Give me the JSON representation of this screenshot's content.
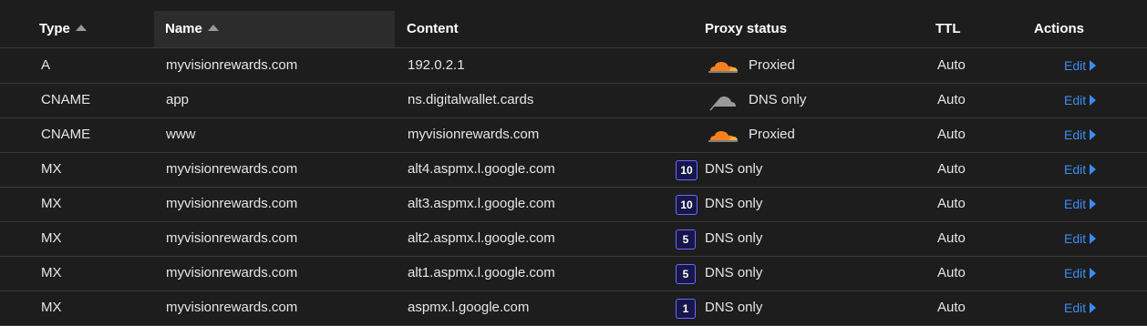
{
  "header": {
    "type": "Type",
    "name": "Name",
    "content": "Content",
    "proxy_status": "Proxy status",
    "ttl": "TTL",
    "actions": "Actions"
  },
  "rows": [
    {
      "type": "A",
      "name": "myvisionrewards.com",
      "content": "192.0.2.1",
      "priority": "",
      "proxy_icon": "cloud-orange-icon",
      "proxy": "Proxied",
      "ttl": "Auto",
      "action": "Edit"
    },
    {
      "type": "CNAME",
      "name": "app",
      "content": "ns.digitalwallet.cards",
      "priority": "",
      "proxy_icon": "cloud-gray-icon",
      "proxy": "DNS only",
      "ttl": "Auto",
      "action": "Edit"
    },
    {
      "type": "CNAME",
      "name": "www",
      "content": "myvisionrewards.com",
      "priority": "",
      "proxy_icon": "cloud-orange-icon",
      "proxy": "Proxied",
      "ttl": "Auto",
      "action": "Edit"
    },
    {
      "type": "MX",
      "name": "myvisionrewards.com",
      "content": "alt4.aspmx.l.google.com",
      "priority": "10",
      "proxy_icon": "",
      "proxy": "DNS only",
      "ttl": "Auto",
      "action": "Edit"
    },
    {
      "type": "MX",
      "name": "myvisionrewards.com",
      "content": "alt3.aspmx.l.google.com",
      "priority": "10",
      "proxy_icon": "",
      "proxy": "DNS only",
      "ttl": "Auto",
      "action": "Edit"
    },
    {
      "type": "MX",
      "name": "myvisionrewards.com",
      "content": "alt2.aspmx.l.google.com",
      "priority": "5",
      "proxy_icon": "",
      "proxy": "DNS only",
      "ttl": "Auto",
      "action": "Edit"
    },
    {
      "type": "MX",
      "name": "myvisionrewards.com",
      "content": "alt1.aspmx.l.google.com",
      "priority": "5",
      "proxy_icon": "",
      "proxy": "DNS only",
      "ttl": "Auto",
      "action": "Edit"
    },
    {
      "type": "MX",
      "name": "myvisionrewards.com",
      "content": "aspmx.l.google.com",
      "priority": "1",
      "proxy_icon": "",
      "proxy": "DNS only",
      "ttl": "Auto",
      "action": "Edit"
    }
  ],
  "colors": {
    "background": "#1d1d1d",
    "link": "#3b8cf0",
    "proxied_cloud": "#f6821f",
    "dns_only_cloud": "#9a9a9a",
    "priority_badge_border": "#6b67ff"
  }
}
